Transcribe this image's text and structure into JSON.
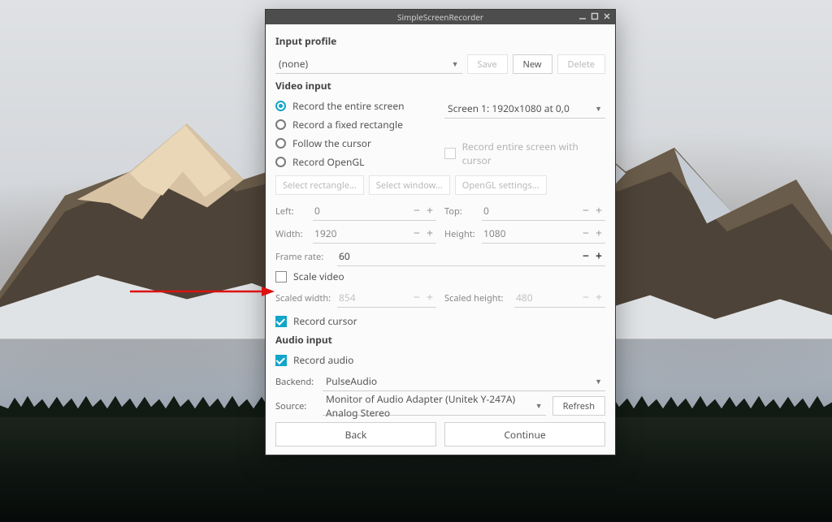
{
  "window": {
    "title": "SimpleScreenRecorder"
  },
  "input_profile": {
    "heading": "Input profile",
    "selected": "(none)",
    "save": "Save",
    "new": "New",
    "delete": "Delete"
  },
  "video_input": {
    "heading": "Video input",
    "opt_entire": "Record the entire screen",
    "opt_rect": "Record a fixed rectangle",
    "opt_cursor": "Follow the cursor",
    "opt_opengl": "Record OpenGL",
    "screen_select": "Screen 1: 1920x1080 at 0,0",
    "record_with_cursor": "Record entire screen with cursor",
    "btn_rect": "Select rectangle...",
    "btn_window": "Select window...",
    "btn_opengl": "OpenGL settings...",
    "left_label": "Left:",
    "left_value": "0",
    "top_label": "Top:",
    "top_value": "0",
    "width_label": "Width:",
    "width_value": "1920",
    "height_label": "Height:",
    "height_value": "1080",
    "framerate_label": "Frame rate:",
    "framerate_value": "60",
    "scale_video": "Scale video",
    "scaled_width_label": "Scaled width:",
    "scaled_width_value": "854",
    "scaled_height_label": "Scaled height:",
    "scaled_height_value": "480",
    "record_cursor": "Record cursor"
  },
  "audio_input": {
    "heading": "Audio input",
    "record_audio": "Record audio",
    "backend_label": "Backend:",
    "backend_value": "PulseAudio",
    "source_label": "Source:",
    "source_value": "Monitor of Audio Adapter (Unitek Y-247A) Analog Stereo",
    "refresh": "Refresh"
  },
  "nav": {
    "back": "Back",
    "continue": "Continue"
  }
}
